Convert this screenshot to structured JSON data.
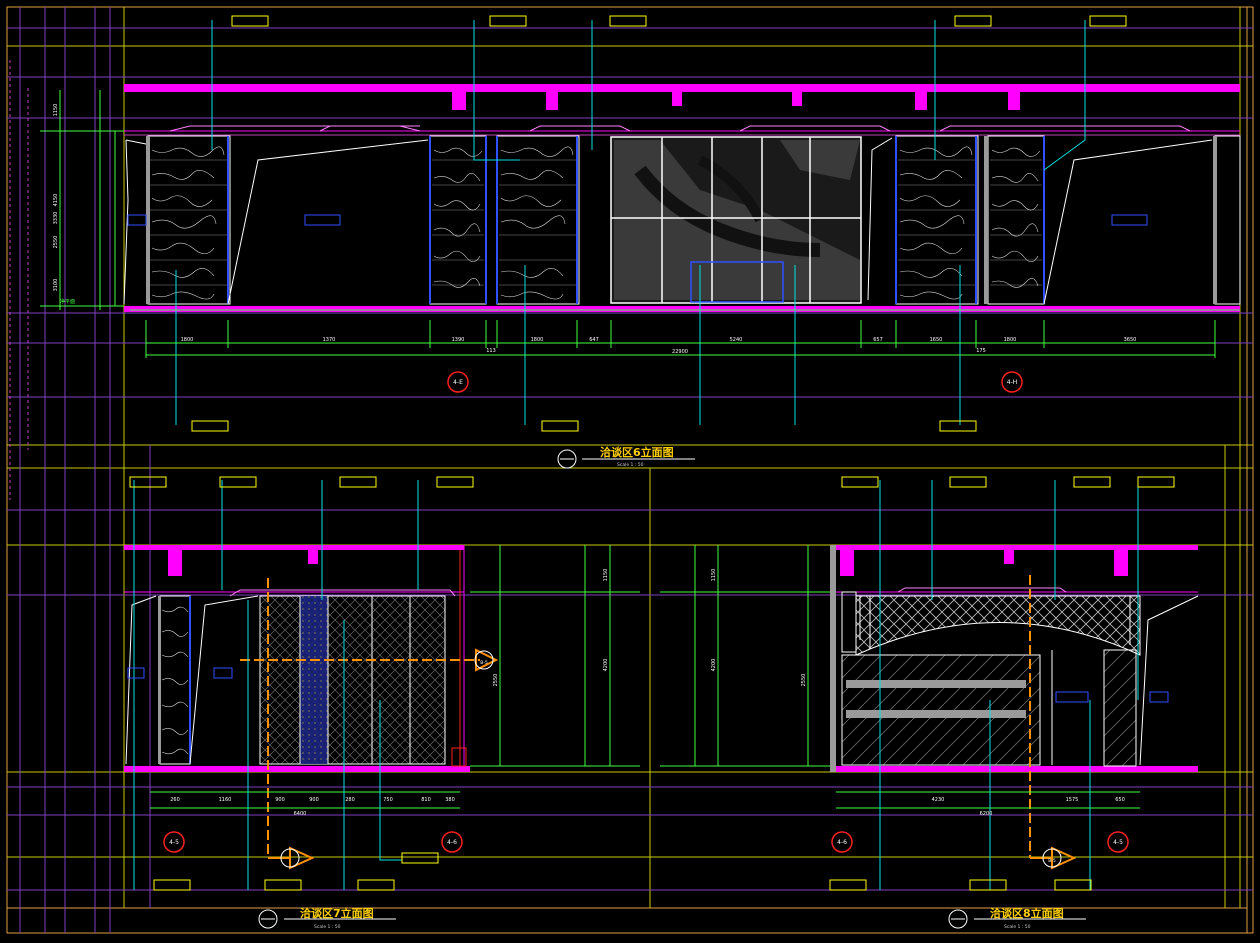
{
  "colors": {
    "background": "#000000",
    "frame": "#e0a040",
    "grid_yellow": "#c8c800",
    "grid_violet": "#8040c0",
    "grid_magenta_thin": "#c040c0",
    "cyan": "#00e0e0",
    "magenta": "#ff00ff",
    "green": "#40ff40",
    "blue": "#3050ff",
    "white": "#ffffff",
    "tag_yellow": "#ffff00",
    "red": "#ff2020",
    "title_yellow": "#ffd000",
    "orange": "#ff9000",
    "grey": "#9a9a9a"
  },
  "drawing": {
    "title_top": "洽谈区6立面图",
    "title_bottom_left": "洽谈区7立面图",
    "title_bottom_right": "洽谈区8立面图",
    "scale_label": "Scale 1 : 50"
  },
  "top_view": {
    "dims_row1": [
      "1800",
      "1370",
      "1390",
      "1800",
      "647",
      "5240",
      "657",
      "1650",
      "1800",
      "3650"
    ],
    "dims_row2": [
      "113",
      "175"
    ],
    "dim_total": "22900",
    "bubbles": [
      "4-E",
      "4-H"
    ],
    "left_dims": [
      "1150",
      "4150",
      "3330",
      "2550",
      "3100"
    ],
    "datum_label": "净平面"
  },
  "bottom_left": {
    "dims": [
      "260",
      "1160",
      "900",
      "900",
      "280",
      "750",
      "810",
      "380"
    ],
    "dim_total": "6400",
    "bubbles": [
      "4-5",
      "4-6"
    ],
    "section_tag": "B-5",
    "right_dims": [
      "1150",
      "4200",
      "2550"
    ]
  },
  "bottom_right": {
    "dims": [
      "4230",
      "1575",
      "650"
    ],
    "dim_total": "6200",
    "bubbles": [
      "4-6",
      "4-5"
    ],
    "section_tag": "B-5",
    "left_dims": [
      "1150",
      "4200",
      "2550"
    ]
  }
}
